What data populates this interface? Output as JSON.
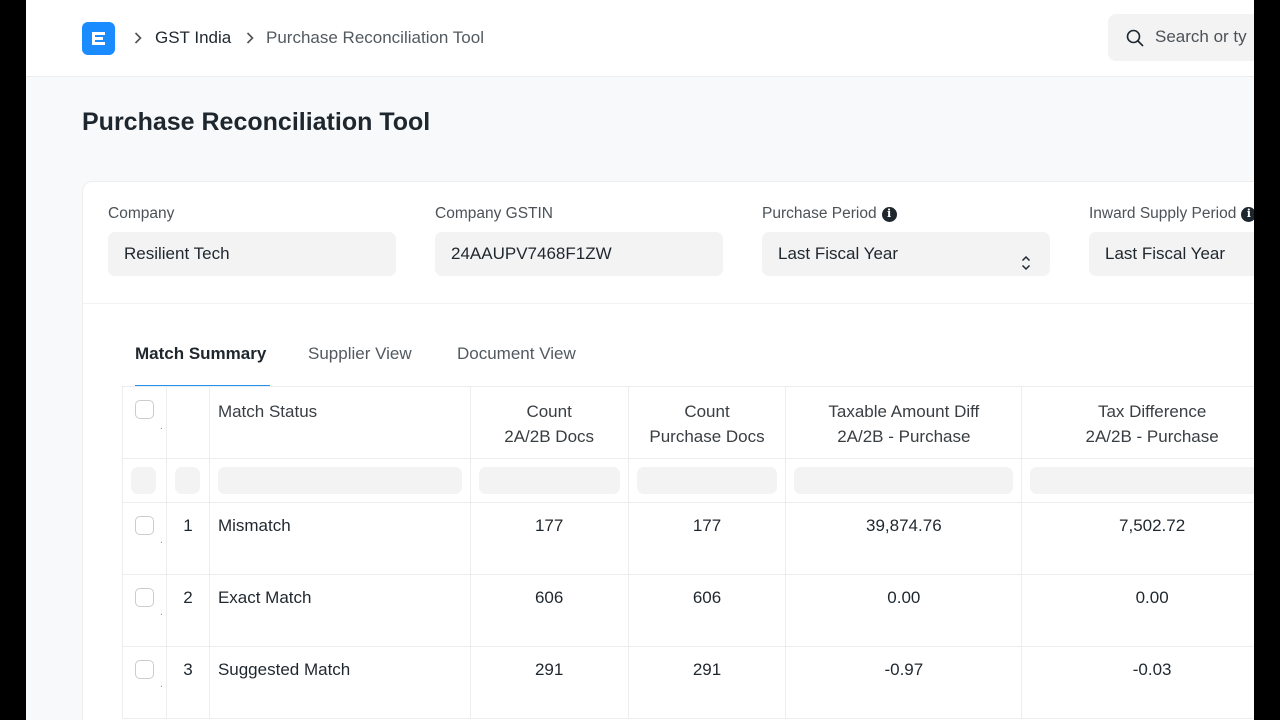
{
  "navbar": {
    "breadcrumbs": [
      "GST India",
      "Purchase Reconciliation Tool"
    ],
    "search_placeholder": "Search or ty"
  },
  "page": {
    "title": "Purchase Reconciliation Tool"
  },
  "filters": {
    "company": {
      "label": "Company",
      "value": "Resilient Tech"
    },
    "gstin": {
      "label": "Company GSTIN",
      "value": "24AAUPV7468F1ZW"
    },
    "purchase_period": {
      "label": "Purchase Period",
      "value": "Last Fiscal Year"
    },
    "inward_period": {
      "label": "Inward Supply Period",
      "value": "Last Fiscal Year"
    }
  },
  "tabs": [
    {
      "label": "Match Summary",
      "active": true
    },
    {
      "label": "Supplier View",
      "active": false
    },
    {
      "label": "Document View",
      "active": false
    }
  ],
  "table": {
    "headers": {
      "status": "Match Status",
      "count_2a_l1": "Count",
      "count_2a_l2": "2A/2B Docs",
      "count_pur_l1": "Count",
      "count_pur_l2": "Purchase Docs",
      "taxable_l1": "Taxable Amount Diff",
      "taxable_l2": "2A/2B - Purchase",
      "taxdiff_l1": "Tax Difference",
      "taxdiff_l2": "2A/2B - Purchase"
    },
    "rows": [
      {
        "idx": "1",
        "status": "Mismatch",
        "count_2a": "177",
        "count_pur": "177",
        "taxable": "39,874.76",
        "taxdiff": "7,502.72"
      },
      {
        "idx": "2",
        "status": "Exact Match",
        "count_2a": "606",
        "count_pur": "606",
        "taxable": "0.00",
        "taxdiff": "0.00"
      },
      {
        "idx": "3",
        "status": "Suggested Match",
        "count_2a": "291",
        "count_pur": "291",
        "taxable": "-0.97",
        "taxdiff": "-0.03"
      }
    ]
  },
  "colors": {
    "accent": "#2490ef",
    "logo": "#1a8cff",
    "input_bg": "#f3f3f3"
  }
}
